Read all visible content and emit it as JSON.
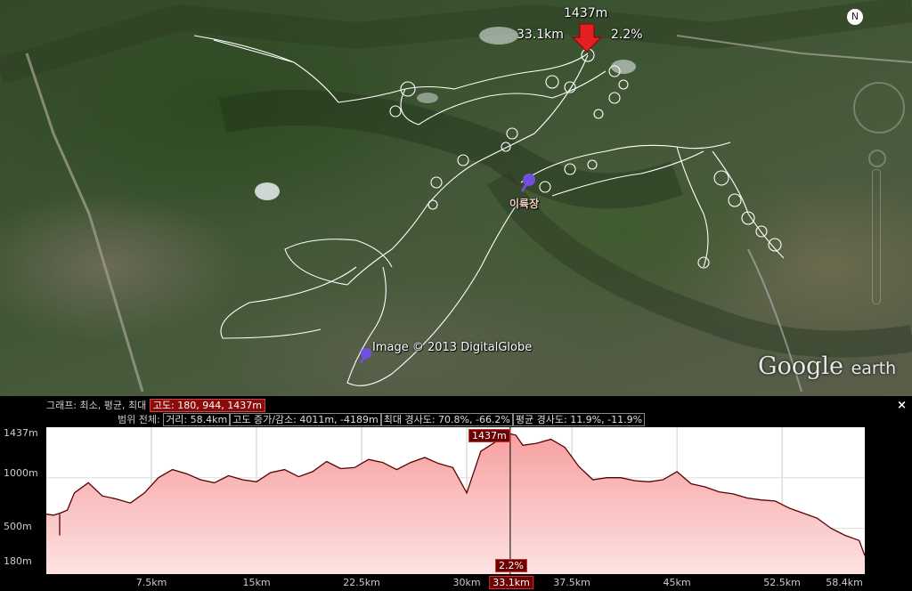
{
  "map": {
    "peak_altitude": "1437m",
    "peak_distance": "33.1km",
    "peak_grade": "2.2%",
    "place_name": "이륙장",
    "copyright": "Image © 2013 DigitalGlobe",
    "logo": "Google",
    "logo_sub": "earth"
  },
  "panel": {
    "graph_label": "그래프: 최소, 평균, 최대",
    "graph_values": "고도: 180, 944, 1437m",
    "range_label": "범위 전체:",
    "distance": "거리: 58.4km",
    "elevation_gain_loss": "고도 증가/감소: 4011m, -4189m",
    "max_slope": "최대 경사도: 70.8%, -66.2%",
    "avg_slope": "평균 경사도: 11.9%, -11.9%",
    "close": "×"
  },
  "chart_data": {
    "type": "area",
    "ylim": [
      180,
      1437
    ],
    "xlim": [
      0,
      58.4
    ],
    "y_ticks": [
      "1437m",
      "1000m",
      "500m",
      "180m"
    ],
    "x_ticks": [
      "7.5km",
      "15km",
      "22.5km",
      "30km",
      "33.1km",
      "37.5km",
      "45km",
      "52.5km",
      "58.4km"
    ],
    "marker": {
      "x": 33.1,
      "altitude_label": "1437m",
      "distance_label": "33.1km",
      "grade_label": "2.2%"
    },
    "series": [
      {
        "x": [
          0,
          0.5,
          1,
          1.5,
          2,
          3,
          4,
          5,
          6,
          7,
          8,
          9,
          10,
          11,
          12,
          13,
          14,
          15,
          16,
          17,
          18,
          19,
          20,
          21,
          22,
          23,
          24,
          25,
          26,
          27,
          28,
          29,
          30,
          31,
          32,
          33,
          33.5,
          34,
          35,
          36,
          37,
          38,
          39,
          40,
          41,
          42,
          43,
          44,
          45,
          46,
          47,
          48,
          49,
          50,
          51,
          52,
          53,
          54,
          55,
          56,
          57,
          58,
          58.4
        ],
        "y": [
          640,
          630,
          650,
          680,
          850,
          950,
          820,
          790,
          750,
          850,
          1000,
          1080,
          1040,
          980,
          950,
          1020,
          980,
          960,
          1050,
          1080,
          1010,
          1060,
          1160,
          1090,
          1100,
          1180,
          1150,
          1080,
          1150,
          1200,
          1140,
          1100,
          850,
          1260,
          1350,
          1437,
          1420,
          1320,
          1340,
          1380,
          1300,
          1110,
          980,
          1000,
          1000,
          970,
          960,
          980,
          1060,
          940,
          910,
          860,
          840,
          800,
          780,
          770,
          700,
          650,
          600,
          500,
          430,
          380,
          230
        ]
      }
    ]
  }
}
